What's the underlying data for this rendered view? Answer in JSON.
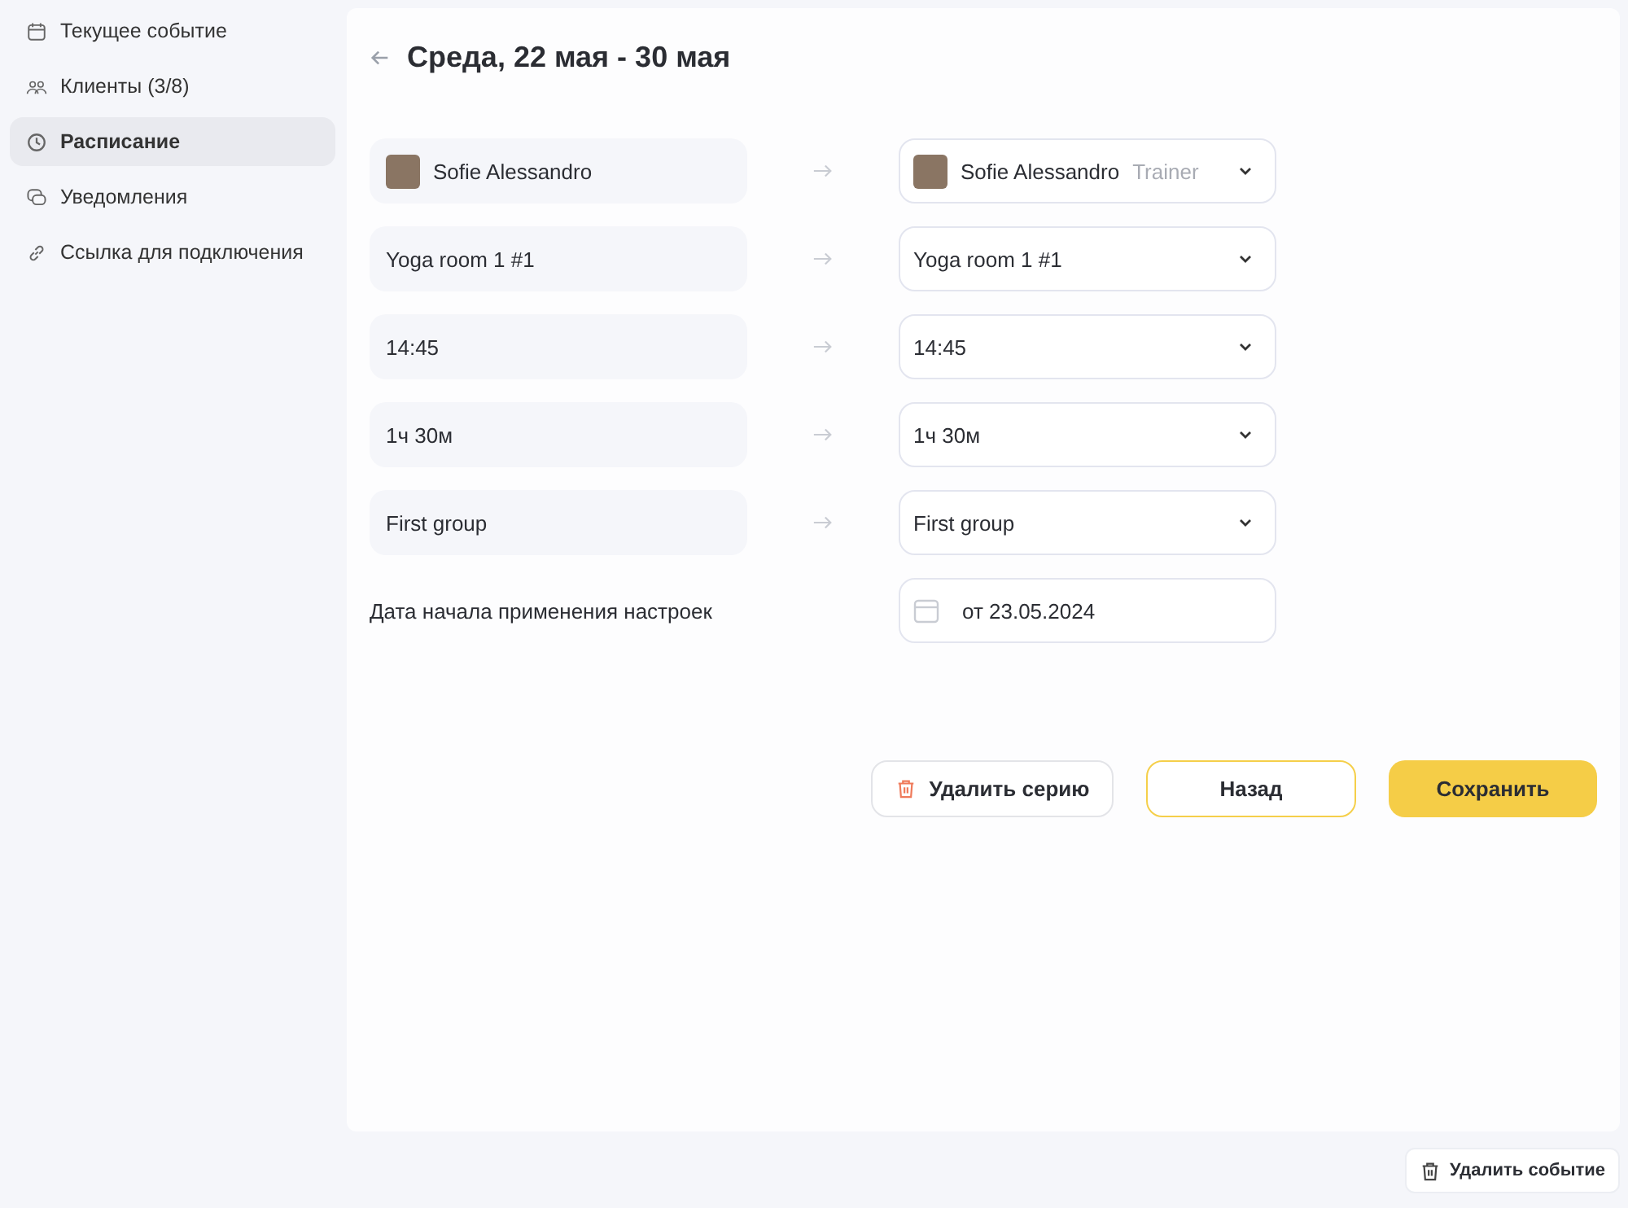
{
  "sidebar": {
    "items": [
      {
        "label": "Текущее событие",
        "kind": "calendar",
        "selected": false
      },
      {
        "label": "Клиенты (3/8)",
        "kind": "people",
        "selected": false
      },
      {
        "label": "Расписание",
        "kind": "clock",
        "selected": true
      },
      {
        "label": "Уведомления",
        "kind": "chat",
        "selected": false
      },
      {
        "label": "Ссылка для подключения",
        "kind": "link",
        "selected": false
      }
    ]
  },
  "header": {
    "title": "Среда, 22 мая - 30 мая"
  },
  "changes": [
    {
      "kind": "person",
      "from": "Sofie Alessandro",
      "to": "Sofie Alessandro",
      "role": "Trainer"
    },
    {
      "kind": "select",
      "from": "Yoga room 1 #1",
      "to": "Yoga room 1 #1"
    },
    {
      "kind": "select",
      "from": "14:45",
      "to": "14:45"
    },
    {
      "kind": "select",
      "from": "1ч 30м",
      "to": "1ч 30м"
    },
    {
      "kind": "select",
      "from": "First group",
      "to": "First group"
    }
  ],
  "start_date": {
    "label": "Дата начала применения настроек",
    "value": "от 23.05.2024"
  },
  "actions": {
    "delete_series": "Удалить серию",
    "back": "Назад",
    "save": "Сохранить"
  },
  "footer": {
    "delete_event": "Удалить событие"
  }
}
